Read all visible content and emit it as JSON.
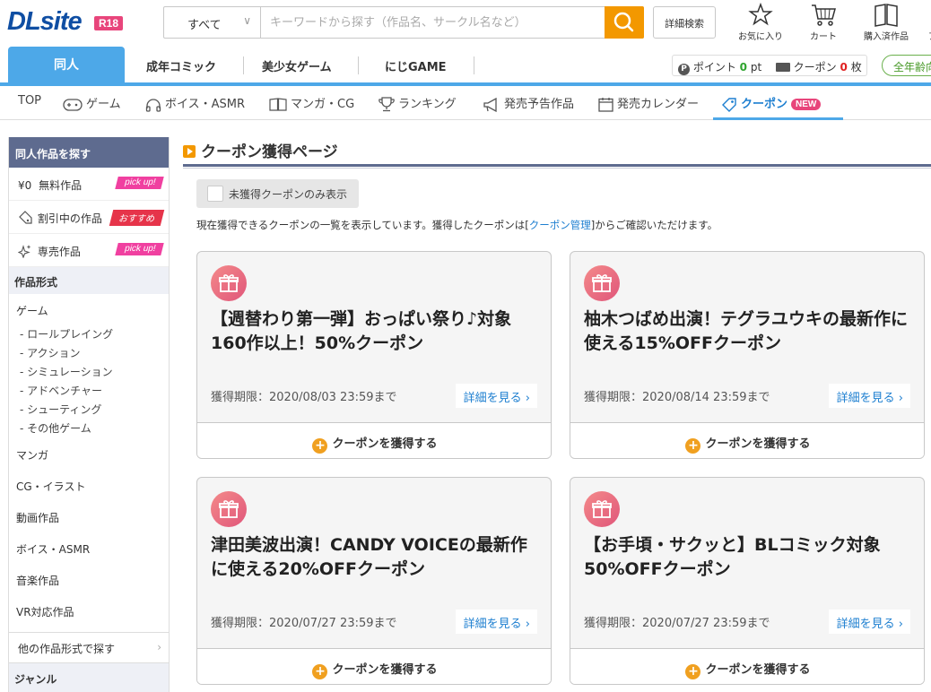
{
  "header": {
    "logo": "DLsite",
    "rating_badge": "R18",
    "search_category": "すべて",
    "search_placeholder": "キーワードから探す（作品名、サークル名など）",
    "advanced_search": "詳細検索",
    "favorites": "お気に入り",
    "cart": "カート",
    "purchased": "購入済作品",
    "overflow_label": "ア"
  },
  "categories": {
    "active": "同人",
    "items": [
      "成年コミック",
      "美少女ゲーム",
      "にじGAME"
    ],
    "points_label": "ポイント",
    "points_value": "0",
    "points_unit": "pt",
    "coupon_label": "クーポン",
    "coupon_value": "0",
    "coupon_unit": "枚",
    "all_ages": "全年齢向"
  },
  "subnav": {
    "items": [
      "TOP",
      "ゲーム",
      "ボイス・ASMR",
      "マンガ・CG",
      "ランキング",
      "発売予告作品",
      "発売カレンダー"
    ],
    "active": "クーポン",
    "new_badge": "NEW"
  },
  "sidebar": {
    "heading": "同人作品を探す",
    "free": {
      "label": "無料作品",
      "prefix": "¥0",
      "tag": "pick up!"
    },
    "discount": {
      "label": "割引中の作品",
      "tag": "おすすめ"
    },
    "exclusive": {
      "label": "専売作品",
      "tag": "pick up!"
    },
    "section_format": "作品形式",
    "game": "ゲーム",
    "game_subs": [
      "- ロールプレイング",
      "- アクション",
      "- シミュレーション",
      "- アドベンチャー",
      "- シューティング",
      "- その他ゲーム"
    ],
    "others": [
      "マンガ",
      "CG・イラスト",
      "動画作品",
      "ボイス・ASMR",
      "音楽作品",
      "VR対応作品"
    ],
    "other_formats": "他の作品形式で探す",
    "genre": "ジャンル"
  },
  "main": {
    "title": "クーポン獲得ページ",
    "filter_label": "未獲得クーポンのみ表示",
    "desc_before": "現在獲得できるクーポンの一覧を表示しています。獲得したクーポンは[",
    "desc_link": "クーポン管理",
    "desc_after": "]からご確認いただけます。",
    "detail_label": "詳細を見る",
    "get_label": "クーポンを獲得する",
    "coupons": [
      {
        "title": "【週替わり第一弾】おっぱい祭り♪対象160作以上！50%クーポン",
        "limit": "獲得期限：2020/08/03 23:59まで"
      },
      {
        "title": "柚木つばめ出演！テグラユウキの最新作に使える15%OFFクーポン",
        "limit": "獲得期限：2020/08/14 23:59まで"
      },
      {
        "title": "津田美波出演！CANDY VOICEの最新作に使える20%OFFクーポン",
        "limit": "獲得期限：2020/07/27 23:59まで"
      },
      {
        "title": "【お手頃・サクッと】BLコミック対象50%OFFクーポン",
        "limit": "獲得期限：2020/07/27 23:59まで"
      }
    ]
  },
  "colors": {
    "brand_blue": "#0f4ea3",
    "accent_blue": "#4da8e8",
    "search_orange": "#f39800",
    "pink": "#e8457b"
  }
}
